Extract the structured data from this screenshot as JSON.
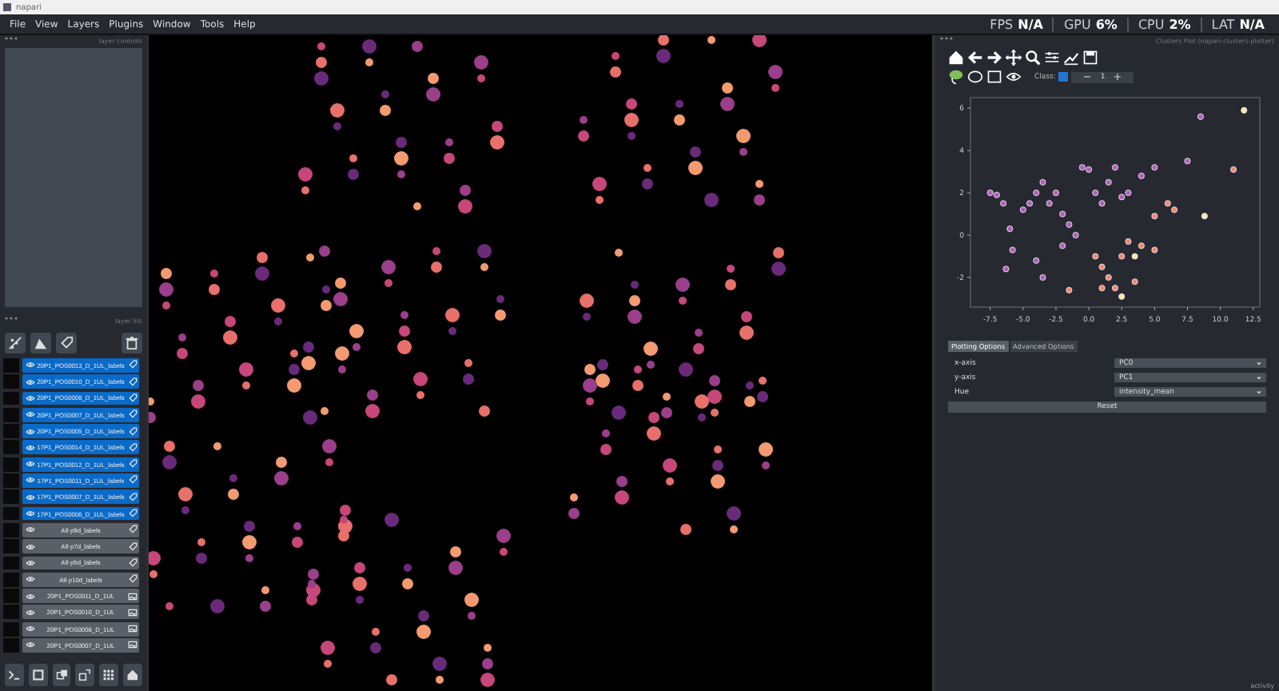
{
  "window": {
    "title": "napari"
  },
  "menu": [
    "File",
    "View",
    "Layers",
    "Plugins",
    "Window",
    "Tools",
    "Help"
  ],
  "status": [
    {
      "label": "FPS",
      "value": "N/A"
    },
    {
      "label": "GPU",
      "value": "6%"
    },
    {
      "label": "CPU",
      "value": "2%"
    },
    {
      "label": "LAT",
      "value": "N/A"
    }
  ],
  "layer_controls": {
    "title": "layer controls"
  },
  "layer_list": {
    "title": "layer list",
    "layers": [
      {
        "name": "20P1_POS0013_D_1UL_labels",
        "kind": "labels",
        "selected": true
      },
      {
        "name": "20P1_POS0010_D_1UL_labels",
        "kind": "labels",
        "selected": true
      },
      {
        "name": "20P1_POS0008_D_1UL_labels",
        "kind": "labels",
        "selected": true
      },
      {
        "name": "20P1_POS0007_D_1UL_labels",
        "kind": "labels",
        "selected": true
      },
      {
        "name": "20P1_POS0005_D_1UL_labels",
        "kind": "labels",
        "selected": true
      },
      {
        "name": "17P1_POS0014_D_1UL_labels",
        "kind": "labels",
        "selected": true
      },
      {
        "name": "17P1_POS0012_D_1UL_labels",
        "kind": "labels",
        "selected": true
      },
      {
        "name": "17P1_POS0011_D_1UL_labels",
        "kind": "labels",
        "selected": true
      },
      {
        "name": "17P1_POS0007_D_1UL_labels",
        "kind": "labels",
        "selected": true
      },
      {
        "name": "17P1_POS0006_D_1UL_labels",
        "kind": "labels",
        "selected": true
      },
      {
        "name": "A9 p9d_labels",
        "kind": "labels",
        "selected": false
      },
      {
        "name": "A9 p7d_labels",
        "kind": "labels",
        "selected": false
      },
      {
        "name": "A9 p5d_labels",
        "kind": "labels",
        "selected": false
      },
      {
        "name": "A9 p10d_labels",
        "kind": "labels",
        "selected": false
      },
      {
        "name": "20P1_POS0011_D_1UL",
        "kind": "image",
        "selected": false
      },
      {
        "name": "20P1_POS0010_D_1UL",
        "kind": "image",
        "selected": false
      },
      {
        "name": "20P1_POS0008_D_1UL",
        "kind": "image",
        "selected": false
      },
      {
        "name": "20P1_POS0007_D_1UL",
        "kind": "image",
        "selected": false
      }
    ]
  },
  "plotter": {
    "title": "Clusters Plot (napari-clusters-plotter)",
    "class_label": "Class:",
    "class_value": "1",
    "chart_data": {
      "type": "scatter",
      "xlim": [
        -9,
        13
      ],
      "ylim": [
        -3.4,
        6.5
      ],
      "xticks": [
        -7.5,
        {
          "value": -5,
          "label": "-5.0"
        },
        -2.5,
        {
          "value": 0,
          "label": "0.0"
        },
        2.5,
        {
          "value": 5,
          "label": "5.0"
        },
        7.5,
        {
          "value": 10,
          "label": "10.0"
        },
        12.5
      ],
      "yticks": [
        -2,
        0,
        2,
        4,
        6
      ],
      "x": [
        -7.5,
        -7,
        -6.5,
        -6,
        -5.8,
        -6.3,
        -5,
        -4.5,
        -4,
        -3.5,
        -3,
        -2.5,
        -2,
        -1.5,
        -0.5,
        0,
        0.5,
        1,
        1.5,
        2,
        2.5,
        3,
        4,
        5,
        -4,
        -3.5,
        -2,
        -1,
        7.5,
        8.5,
        0.5,
        1,
        1.5,
        1,
        2,
        2.5,
        3,
        4,
        5,
        6,
        6.5,
        5,
        3.5,
        -1.5,
        11,
        2.5,
        8.8,
        3.5,
        11.8
      ],
      "series": [
        {
          "color": "#b060b8",
          "values": [
            2,
            1.9,
            1.5,
            0.3,
            -0.7,
            -1.6,
            1.2,
            1.5,
            2,
            2.5,
            1.5,
            2,
            1,
            0.5,
            3.2,
            3.1,
            2,
            1.5,
            2.5,
            3.2,
            1.8,
            2,
            2.8,
            3.2,
            -1.2,
            -2,
            -0.5,
            0,
            3.5,
            5.6,
            null,
            null,
            null,
            null,
            null,
            null,
            null,
            null,
            null,
            null,
            null,
            null,
            null,
            null,
            null,
            null,
            null,
            null,
            null
          ]
        },
        {
          "color": "#f08a6a",
          "values": [
            null,
            null,
            null,
            null,
            null,
            null,
            null,
            null,
            null,
            null,
            null,
            null,
            null,
            null,
            null,
            null,
            null,
            null,
            null,
            null,
            null,
            null,
            null,
            null,
            null,
            null,
            null,
            null,
            null,
            null,
            -1,
            -1.5,
            -2,
            -2.5,
            -2.5,
            -1,
            -0.3,
            -0.5,
            0.9,
            1.5,
            1.2,
            -0.7,
            -2.2,
            -2.6,
            3.1,
            null,
            null,
            null,
            null
          ]
        },
        {
          "color": "#fbe9a8",
          "values": [
            null,
            null,
            null,
            null,
            null,
            null,
            null,
            null,
            null,
            null,
            null,
            null,
            null,
            null,
            null,
            null,
            null,
            null,
            null,
            null,
            null,
            null,
            null,
            null,
            null,
            null,
            null,
            null,
            null,
            null,
            null,
            null,
            null,
            null,
            null,
            null,
            null,
            null,
            null,
            null,
            null,
            null,
            null,
            null,
            null,
            -2.9,
            0.9,
            -1,
            5.9
          ]
        }
      ]
    },
    "tabs": [
      {
        "label": "Plotting Options",
        "selected": true
      },
      {
        "label": "Advanced Options",
        "selected": false
      }
    ],
    "options": [
      {
        "label": "x-axis",
        "value": "PC0"
      },
      {
        "label": "y-axis",
        "value": "PC1"
      },
      {
        "label": "Hue",
        "value": "intensity_mean"
      }
    ],
    "reset_button": "Reset"
  },
  "activity": "activity"
}
